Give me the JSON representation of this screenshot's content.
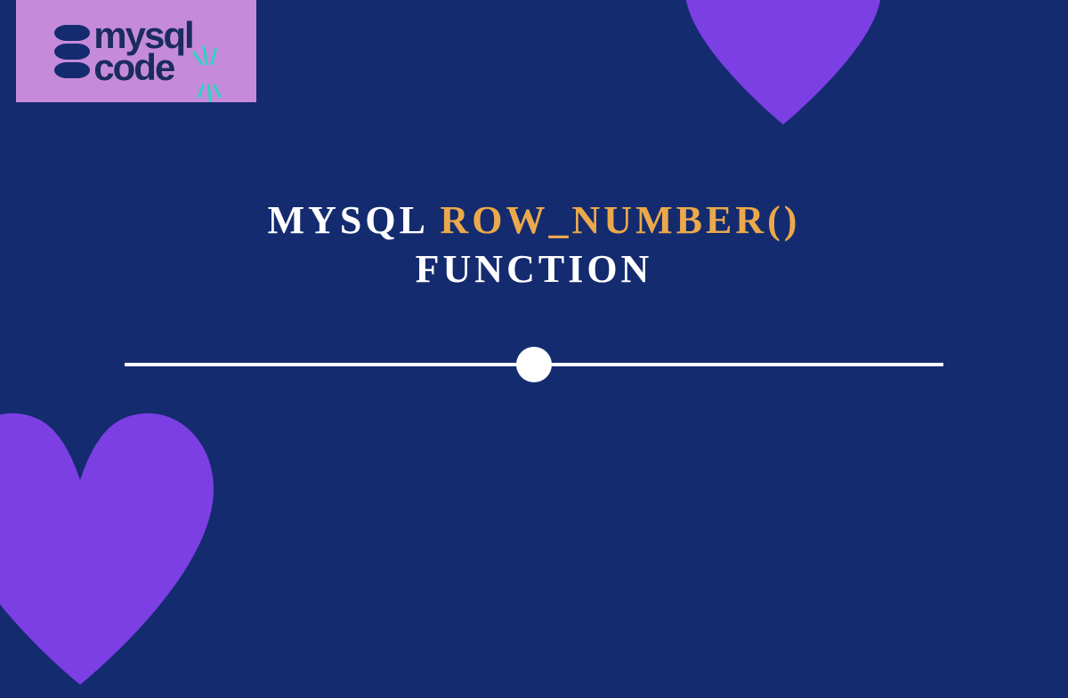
{
  "logo": {
    "line1": "mysql",
    "line2": "code"
  },
  "title": {
    "part1": "MYSQL",
    "part2": "ROW_NUMBER()",
    "part3": "FUNCTION"
  },
  "colors": {
    "background": "#142B6F",
    "accent_text": "#EBA94B",
    "heart": "#7B3FE4",
    "logo_bg": "#C58BDA",
    "spark": "#2DD4BF"
  }
}
